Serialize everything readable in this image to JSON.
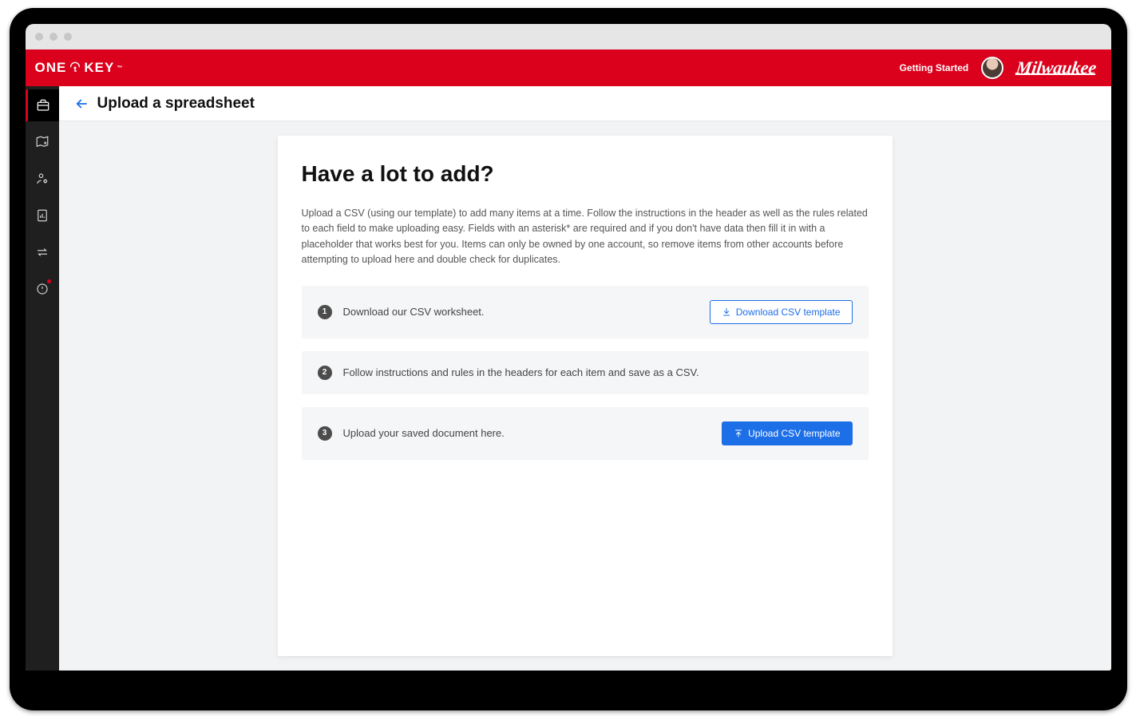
{
  "header": {
    "logo_text_left": "ONE",
    "logo_text_right": "KEY",
    "getting_started": "Getting Started",
    "brand": "Milwaukee"
  },
  "page": {
    "title": "Upload a spreadsheet"
  },
  "card": {
    "heading": "Have a lot to add?",
    "description": "Upload a CSV (using our template) to add many items at a time. Follow the instructions in the header as well as the rules related to each field to make uploading easy. Fields with an asterisk* are required and if you don't have data then fill it in with a placeholder that works best for you. Items can only be owned by one account, so remove items from other accounts before attempting to upload here and double check for duplicates."
  },
  "steps": [
    {
      "num": "1",
      "text": "Download our CSV worksheet.",
      "button": "Download CSV template"
    },
    {
      "num": "2",
      "text": "Follow instructions and rules in the headers for each item and save as a CSV."
    },
    {
      "num": "3",
      "text": "Upload your saved document here.",
      "button": "Upload CSV template"
    }
  ]
}
